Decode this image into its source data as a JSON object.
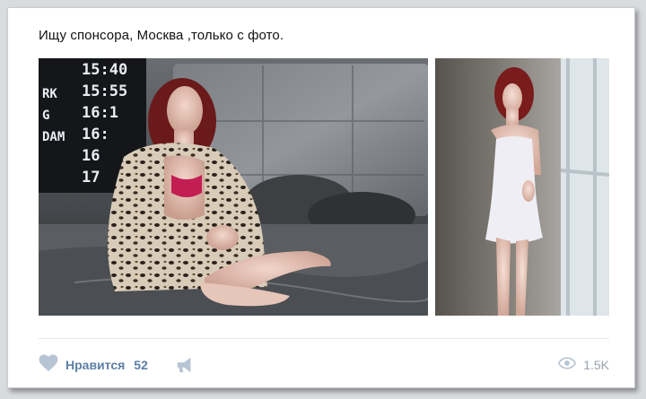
{
  "post": {
    "text": "Ищу спонсора, Москва ,только с фото."
  },
  "photos": {
    "first": {
      "board_rows": [
        {
          "left": "",
          "time": "15:40"
        },
        {
          "left": "RK",
          "time": "15:55"
        },
        {
          "left": "G",
          "time": "16:1"
        },
        {
          "left": "DAM",
          "time": "16:"
        },
        {
          "left": "",
          "time": "16"
        },
        {
          "left": "",
          "time": "17"
        }
      ]
    }
  },
  "actions": {
    "like_label": "Нравится",
    "like_count": "52",
    "views_count": "1.5K"
  },
  "icons": {
    "like": "heart-icon",
    "share": "megaphone-icon",
    "views": "eye-icon"
  },
  "colors": {
    "accent": "#5c7fa5",
    "icon": "#b7c4d3",
    "muted": "#9aa3ad"
  }
}
